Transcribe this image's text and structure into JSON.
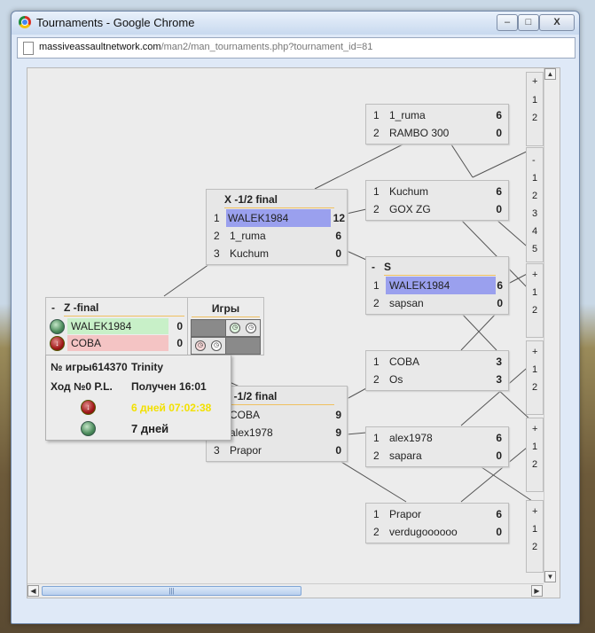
{
  "window": {
    "title": "Tournaments - Google Chrome",
    "url_host": "massiveassaultnetwork.com",
    "url_path": "/man2/man_tournaments.php?tournament_id=81",
    "controls": {
      "minimize": "–",
      "maximize": "□",
      "close": "X"
    }
  },
  "bracket": {
    "semi_x": {
      "title": "X -1/2 final",
      "collapse": "-",
      "rows": [
        {
          "n": "1",
          "name": "WALEK1984",
          "score": "12",
          "highlight": true
        },
        {
          "n": "2",
          "name": "1_ruma",
          "score": "6"
        },
        {
          "n": "3",
          "name": "Kuchum",
          "score": "0"
        }
      ]
    },
    "semi_t": {
      "title": "T -1/2 final",
      "rows": [
        {
          "n": "1",
          "name": "COBA",
          "score": "9"
        },
        {
          "n": "2",
          "name": "alex1978",
          "score": "9"
        },
        {
          "n": "3",
          "name": "Prapor",
          "score": "0"
        }
      ]
    },
    "group_s": {
      "title": "S",
      "collapse": "-",
      "rows": [
        {
          "n": "1",
          "name": "WALEK1984",
          "score": "6",
          "highlight": true
        },
        {
          "n": "2",
          "name": "sapsan",
          "score": "0"
        }
      ]
    },
    "matches": [
      {
        "rows": [
          {
            "n": "1",
            "name": "1_ruma",
            "score": "6"
          },
          {
            "n": "2",
            "name": "RAMBO 300",
            "score": "0"
          }
        ]
      },
      {
        "rows": [
          {
            "n": "1",
            "name": "Kuchum",
            "score": "6"
          },
          {
            "n": "2",
            "name": "GOX ZG",
            "score": "0"
          }
        ]
      },
      {
        "rows": [
          {
            "n": "1",
            "name": "COBA",
            "score": "3"
          },
          {
            "n": "2",
            "name": "Os",
            "score": "3"
          }
        ]
      },
      {
        "rows": [
          {
            "n": "1",
            "name": "alex1978",
            "score": "6"
          },
          {
            "n": "2",
            "name": "sapara",
            "score": "0"
          }
        ]
      },
      {
        "rows": [
          {
            "n": "1",
            "name": "Prapor",
            "score": "6"
          },
          {
            "n": "2",
            "name": "verdugoooooo",
            "score": "0"
          }
        ]
      }
    ],
    "edge_boxes": [
      {
        "top": "+",
        "items": [
          "1",
          "2"
        ]
      },
      {
        "top": "-",
        "items": [
          "1",
          "2",
          "3",
          "4",
          "5"
        ]
      },
      {
        "top": "+",
        "items": [
          "1",
          "2"
        ]
      },
      {
        "top": "+",
        "items": [
          "1",
          "2"
        ]
      },
      {
        "top": "+",
        "items": [
          "1",
          "2"
        ]
      },
      {
        "top": "+",
        "items": [
          "1",
          "2"
        ]
      }
    ]
  },
  "final": {
    "collapse": "-",
    "title": "Z -final",
    "rows": [
      {
        "name": "WALEK1984",
        "score": "0",
        "bg": "#c8f0c8"
      },
      {
        "name": "COBA",
        "score": "0",
        "bg": "#f4c4c4"
      }
    ],
    "games_header": "Игры"
  },
  "tooltip": {
    "game_no": "№ игры614370",
    "map": "Trinity",
    "turn": "Ход №0 P.L.",
    "received": "Получен 16:01",
    "countdown": "6 дней 07:02:38",
    "days": "7 дней"
  },
  "colors": {
    "highlight": "#9aa0ee",
    "accent": "#f0c060",
    "countdown": "#f2e000"
  }
}
